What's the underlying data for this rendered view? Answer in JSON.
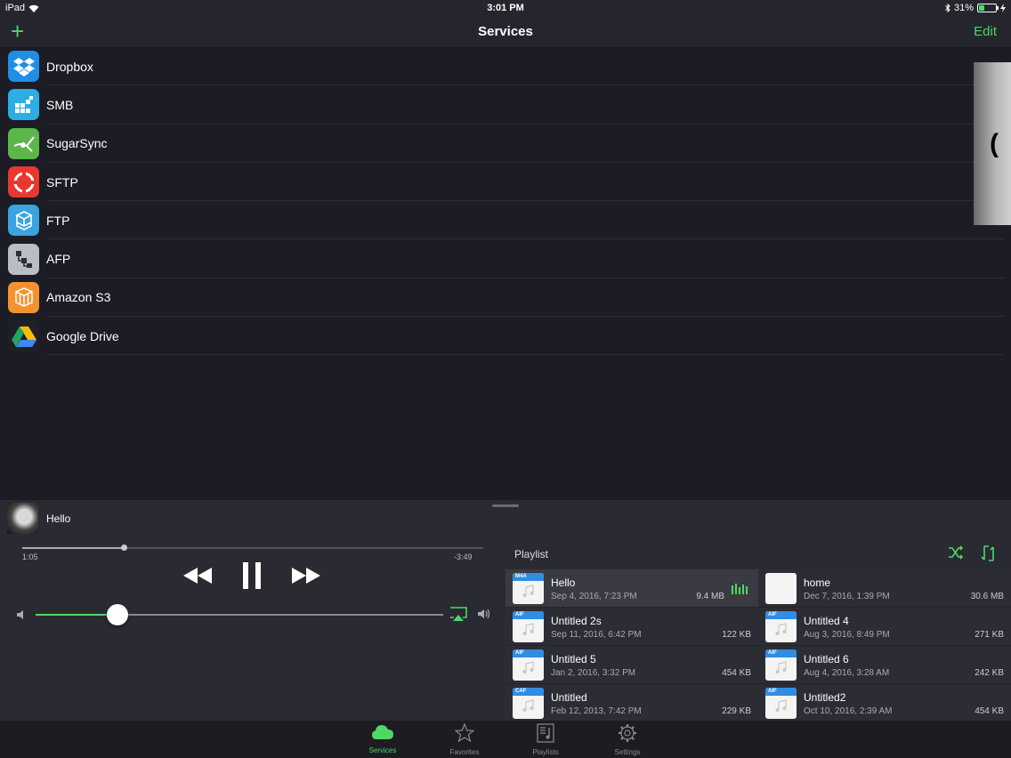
{
  "status_bar": {
    "device": "iPad",
    "time": "3:01 PM",
    "battery": "31%",
    "battery_level": 0.31
  },
  "nav": {
    "title": "Services",
    "add_label": "+",
    "edit_label": "Edit"
  },
  "services": [
    {
      "label": "Dropbox",
      "icon": "dropbox-icon",
      "color": "#1f8fe6"
    },
    {
      "label": "SMB",
      "icon": "smb-icon",
      "color": "#2aaee4"
    },
    {
      "label": "SugarSync",
      "icon": "sugarsync-icon",
      "color": "#5cb64a"
    },
    {
      "label": "SFTP",
      "icon": "sftp-icon",
      "color": "#e8382f"
    },
    {
      "label": "FTP",
      "icon": "ftp-icon",
      "color": "#3aa4e0"
    },
    {
      "label": "AFP",
      "icon": "afp-icon",
      "color": "#b8bec4"
    },
    {
      "label": "Amazon S3",
      "icon": "amazon-s3-icon",
      "color": "#f5922f"
    },
    {
      "label": "Google Drive",
      "icon": "google-drive-icon",
      "color": "#1f1f27"
    }
  ],
  "player": {
    "now_playing": "Hello",
    "elapsed": "1:05",
    "remaining": "-3:49",
    "progress": 0.22,
    "volume": 0.2
  },
  "playlist": {
    "title": "Playlist",
    "tracks": [
      {
        "name": "Hello",
        "date": "Sep 4, 2016, 7:23 PM",
        "size": "9.4 MB",
        "type": "M4A",
        "current": true
      },
      {
        "name": "home",
        "date": "Dec 7, 2016, 1:39 PM",
        "size": "30.6 MB",
        "type": "",
        "current": false
      },
      {
        "name": "Untitled 2s",
        "date": "Sep 11, 2016, 6:42 PM",
        "size": "122 KB",
        "type": "AIF",
        "current": false
      },
      {
        "name": "Untitled 4",
        "date": "Aug 3, 2016, 8:49 PM",
        "size": "271 KB",
        "type": "AIF",
        "current": false
      },
      {
        "name": "Untitled 5",
        "date": "Jan 2, 2016, 3:32 PM",
        "size": "454 KB",
        "type": "AIF",
        "current": false
      },
      {
        "name": "Untitled 6",
        "date": "Aug 4, 2016, 3:28 AM",
        "size": "242 KB",
        "type": "AIF",
        "current": false
      },
      {
        "name": "Untitled",
        "date": "Feb 12, 2013, 7:42 PM",
        "size": "229 KB",
        "type": "CAF",
        "current": false
      },
      {
        "name": "Untitled2",
        "date": "Oct 10, 2016, 2:39 AM",
        "size": "454 KB",
        "type": "AIF",
        "current": false
      }
    ]
  },
  "tabs": [
    {
      "label": "Services",
      "icon": "cloud-icon",
      "active": true
    },
    {
      "label": "Favorites",
      "icon": "star-icon",
      "active": false
    },
    {
      "label": "Playlists",
      "icon": "playlist-icon",
      "active": false
    },
    {
      "label": "Settings",
      "icon": "gear-icon",
      "active": false
    }
  ],
  "colors": {
    "accent": "#4cd964",
    "background": "#1c1c25",
    "panel": "#2a2a32"
  }
}
